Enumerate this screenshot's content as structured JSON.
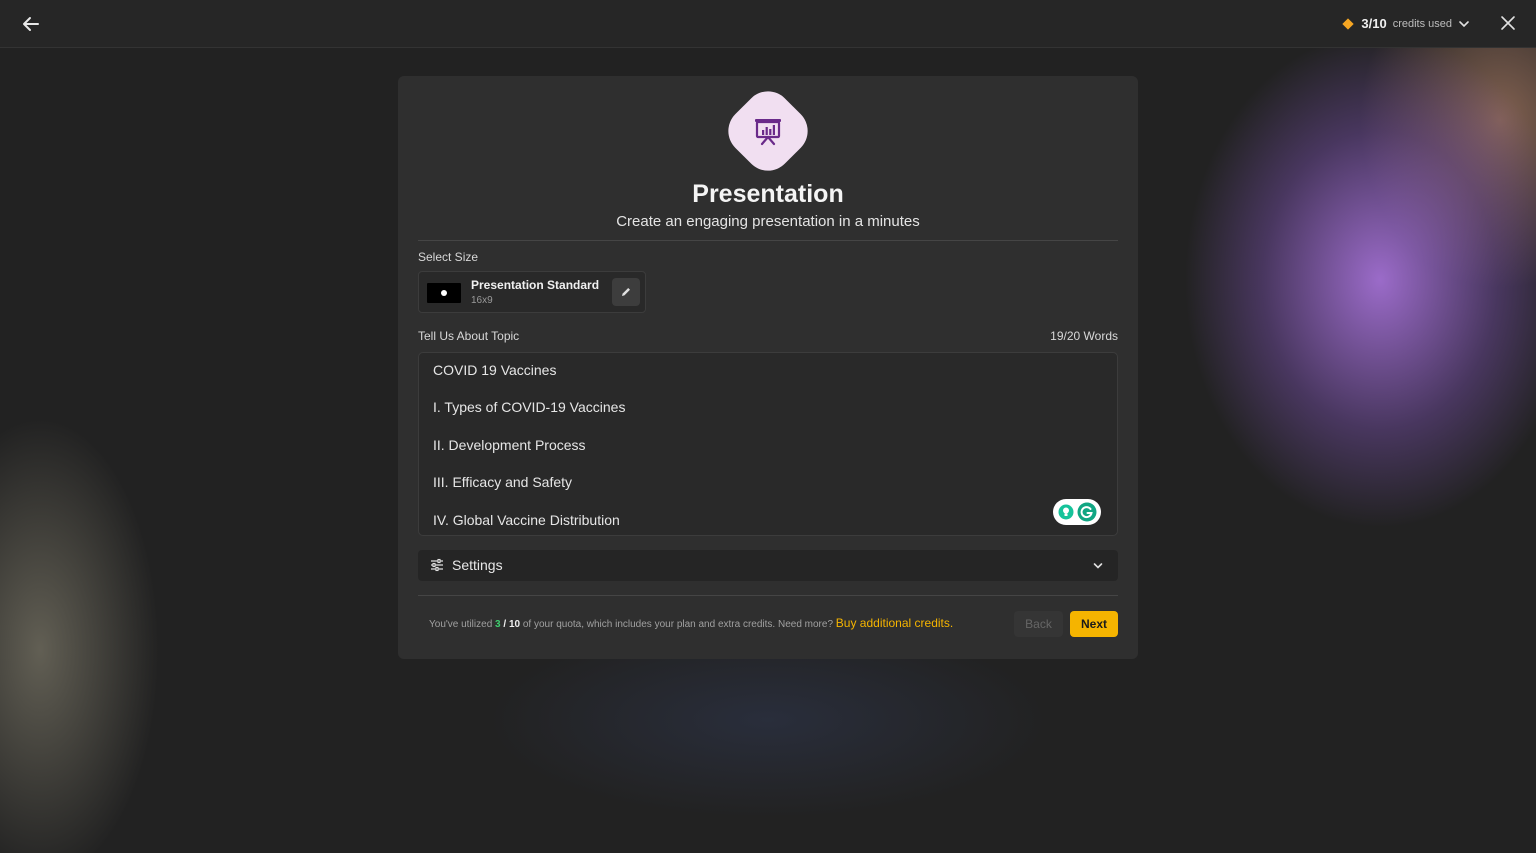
{
  "topbar": {
    "credits_used": "3/10",
    "credits_label": "credits used",
    "accent_color": "#f5a623"
  },
  "card": {
    "title": "Presentation",
    "subtitle": "Create an engaging presentation in a minutes",
    "select_size_label": "Select Size",
    "size": {
      "name": "Presentation Standard",
      "ratio": "16x9"
    },
    "topic_label": "Tell Us About Topic",
    "word_count": "19/20 Words",
    "topic_lines": [
      "COVID 19 Vaccines",
      "I. Types of COVID-19 Vaccines",
      "II. Development Process",
      "III. Efficacy and Safety",
      "IV. Global Vaccine Distribution"
    ],
    "settings_label": "Settings",
    "footer": {
      "prefix": "You've utilized ",
      "used": "3",
      "separator": " / ",
      "total": "10",
      "suffix": " of your quota, which includes your plan and extra credits. Need more? ",
      "buy_link": "Buy additional credits."
    },
    "back_label": "Back",
    "next_label": "Next",
    "next_color": "#f5b400"
  }
}
